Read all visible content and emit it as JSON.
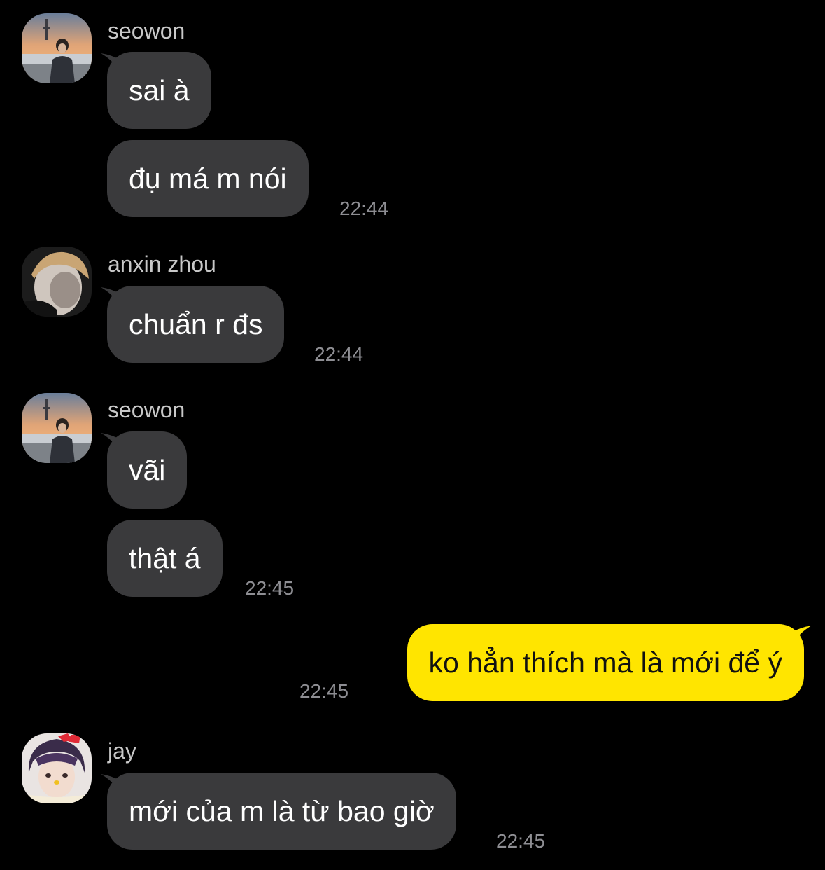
{
  "colors": {
    "background": "#000000",
    "incoming_bubble": "#3a3a3c",
    "outgoing_bubble": "#ffe500",
    "timestamp": "#8e8e93",
    "sender_name": "#c8c8c8"
  },
  "messages": [
    {
      "sender": "seowon",
      "avatar": "seowon-avatar",
      "texts": [
        "sai à",
        "đụ má m nói"
      ],
      "time": "22:44"
    },
    {
      "sender": "anxin zhou",
      "avatar": "anxin-zhou-avatar",
      "texts": [
        "chuẩn r đs"
      ],
      "time": "22:44"
    },
    {
      "sender": "seowon",
      "avatar": "seowon-avatar",
      "texts": [
        "vãi",
        "thật á"
      ],
      "time": "22:45"
    },
    {
      "sender": "",
      "outgoing": true,
      "texts": [
        "ko hẳn thích mà là mới để ý"
      ],
      "time": "22:45"
    },
    {
      "sender": "jay",
      "avatar": "jay-avatar",
      "texts": [
        "mới của m là từ bao giờ"
      ],
      "time": "22:45"
    }
  ]
}
